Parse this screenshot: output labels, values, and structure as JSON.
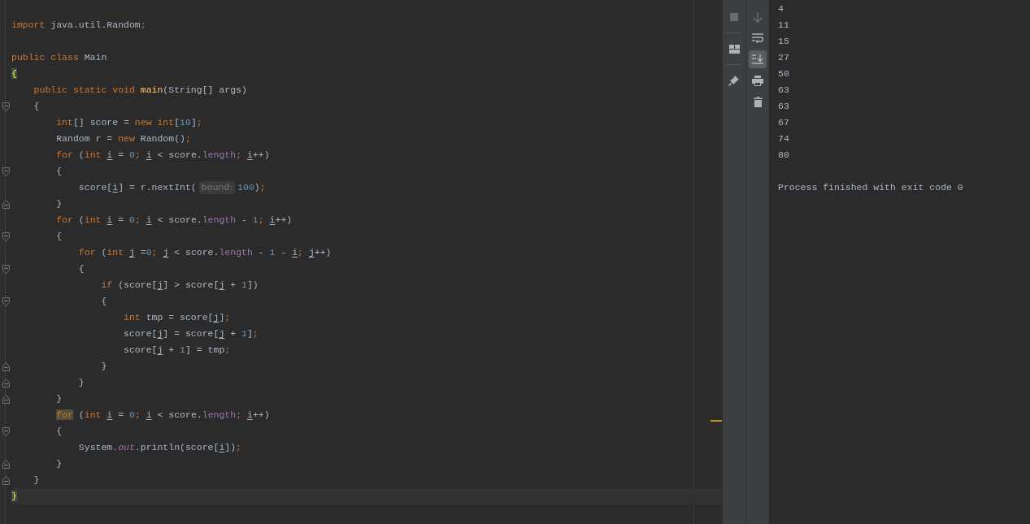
{
  "editor": {
    "lines": [
      {
        "kind": "blank"
      },
      {
        "tokens": [
          {
            "text": "import ",
            "kind": "kw"
          },
          {
            "text": "java.util.Random",
            "kind": "plain"
          },
          {
            "text": ";",
            "kind": "kw"
          }
        ]
      },
      {
        "kind": "blank"
      },
      {
        "tokens": [
          {
            "text": "public class ",
            "kind": "kw"
          },
          {
            "text": "Main",
            "kind": "plain"
          }
        ]
      },
      {
        "tokens": [
          {
            "text": "{",
            "kind": "brace"
          }
        ]
      },
      {
        "tokens": [
          {
            "text": "    public static void ",
            "kind": "kw"
          },
          {
            "text": "main",
            "kind": "method"
          },
          {
            "text": "(String[] args)",
            "kind": "plain"
          }
        ]
      },
      {
        "kind": "block-start",
        "tokens": [
          {
            "text": "    {",
            "kind": "plain"
          }
        ]
      },
      {
        "tokens": [
          {
            "text": "        int",
            "kind": "kw"
          },
          {
            "text": "[] score = ",
            "kind": "plain"
          },
          {
            "text": "new int",
            "kind": "kw"
          },
          {
            "text": "[",
            "kind": "plain"
          },
          {
            "text": "10",
            "kind": "num"
          },
          {
            "text": "]",
            "kind": "plain"
          },
          {
            "text": ";",
            "kind": "kw"
          }
        ]
      },
      {
        "tokens": [
          {
            "text": "        Random r = ",
            "kind": "plain"
          },
          {
            "text": "new ",
            "kind": "kw"
          },
          {
            "text": "Random()",
            "kind": "plain"
          },
          {
            "text": ";",
            "kind": "kw"
          }
        ]
      },
      {
        "tokens": [
          {
            "text": "        for ",
            "kind": "kw"
          },
          {
            "text": "(",
            "kind": "plain"
          },
          {
            "text": "int ",
            "kind": "kw"
          },
          {
            "text": "i",
            "kind": "var"
          },
          {
            "text": " = ",
            "kind": "plain"
          },
          {
            "text": "0",
            "kind": "num"
          },
          {
            "text": "; ",
            "kind": "kw"
          },
          {
            "text": "i",
            "kind": "var"
          },
          {
            "text": " < score.",
            "kind": "plain"
          },
          {
            "text": "length",
            "kind": "field"
          },
          {
            "text": "; ",
            "kind": "kw"
          },
          {
            "text": "i",
            "kind": "var"
          },
          {
            "text": "++)",
            "kind": "plain"
          }
        ]
      },
      {
        "kind": "block-start",
        "tokens": [
          {
            "text": "        {",
            "kind": "plain"
          }
        ]
      },
      {
        "tokens": [
          {
            "text": "            score[",
            "kind": "plain"
          },
          {
            "text": "i",
            "kind": "var"
          },
          {
            "text": "] = r.nextInt(",
            "kind": "plain"
          },
          {
            "text": "bound:",
            "kind": "hint"
          },
          {
            "text": "100",
            "kind": "num"
          },
          {
            "text": ")",
            "kind": "plain"
          },
          {
            "text": ";",
            "kind": "kw"
          }
        ]
      },
      {
        "kind": "block-end",
        "tokens": [
          {
            "text": "        }",
            "kind": "plain"
          }
        ]
      },
      {
        "tokens": [
          {
            "text": "        for ",
            "kind": "kw"
          },
          {
            "text": "(",
            "kind": "plain"
          },
          {
            "text": "int ",
            "kind": "kw"
          },
          {
            "text": "i",
            "kind": "var"
          },
          {
            "text": " = ",
            "kind": "plain"
          },
          {
            "text": "0",
            "kind": "num"
          },
          {
            "text": "; ",
            "kind": "kw"
          },
          {
            "text": "i",
            "kind": "var"
          },
          {
            "text": " < score.",
            "kind": "plain"
          },
          {
            "text": "length",
            "kind": "field"
          },
          {
            "text": " - ",
            "kind": "plain"
          },
          {
            "text": "1",
            "kind": "num"
          },
          {
            "text": "; ",
            "kind": "kw"
          },
          {
            "text": "i",
            "kind": "var"
          },
          {
            "text": "++)",
            "kind": "plain"
          }
        ]
      },
      {
        "kind": "block-start",
        "tokens": [
          {
            "text": "        {",
            "kind": "plain"
          }
        ]
      },
      {
        "tokens": [
          {
            "text": "            for ",
            "kind": "kw"
          },
          {
            "text": "(",
            "kind": "plain"
          },
          {
            "text": "int ",
            "kind": "kw"
          },
          {
            "text": "j",
            "kind": "var"
          },
          {
            "text": " =",
            "kind": "plain"
          },
          {
            "text": "0",
            "kind": "num"
          },
          {
            "text": "; ",
            "kind": "kw"
          },
          {
            "text": "j",
            "kind": "var"
          },
          {
            "text": " < score.",
            "kind": "plain"
          },
          {
            "text": "length",
            "kind": "field"
          },
          {
            "text": " - ",
            "kind": "plain"
          },
          {
            "text": "1",
            "kind": "num"
          },
          {
            "text": " - ",
            "kind": "plain"
          },
          {
            "text": "i",
            "kind": "var"
          },
          {
            "text": "; ",
            "kind": "kw"
          },
          {
            "text": "j",
            "kind": "var"
          },
          {
            "text": "++)",
            "kind": "plain"
          }
        ]
      },
      {
        "kind": "block-start",
        "tokens": [
          {
            "text": "            {",
            "kind": "plain"
          }
        ]
      },
      {
        "tokens": [
          {
            "text": "                if ",
            "kind": "kw"
          },
          {
            "text": "(score[",
            "kind": "plain"
          },
          {
            "text": "j",
            "kind": "var"
          },
          {
            "text": "] > score[",
            "kind": "plain"
          },
          {
            "text": "j",
            "kind": "var"
          },
          {
            "text": " + ",
            "kind": "plain"
          },
          {
            "text": "1",
            "kind": "num"
          },
          {
            "text": "])",
            "kind": "plain"
          }
        ]
      },
      {
        "kind": "block-start",
        "tokens": [
          {
            "text": "                {",
            "kind": "plain"
          }
        ]
      },
      {
        "tokens": [
          {
            "text": "                    int ",
            "kind": "kw"
          },
          {
            "text": "tmp = score[",
            "kind": "plain"
          },
          {
            "text": "j",
            "kind": "var"
          },
          {
            "text": "]",
            "kind": "plain"
          },
          {
            "text": ";",
            "kind": "kw"
          }
        ]
      },
      {
        "tokens": [
          {
            "text": "                    score[",
            "kind": "plain"
          },
          {
            "text": "j",
            "kind": "var"
          },
          {
            "text": "] = score[",
            "kind": "plain"
          },
          {
            "text": "j",
            "kind": "var"
          },
          {
            "text": " + ",
            "kind": "plain"
          },
          {
            "text": "1",
            "kind": "num"
          },
          {
            "text": "]",
            "kind": "plain"
          },
          {
            "text": ";",
            "kind": "kw"
          }
        ]
      },
      {
        "tokens": [
          {
            "text": "                    score[",
            "kind": "plain"
          },
          {
            "text": "j",
            "kind": "var"
          },
          {
            "text": " + ",
            "kind": "plain"
          },
          {
            "text": "1",
            "kind": "num"
          },
          {
            "text": "] = tmp",
            "kind": "plain"
          },
          {
            "text": ";",
            "kind": "kw"
          }
        ]
      },
      {
        "kind": "block-end",
        "tokens": [
          {
            "text": "                }",
            "kind": "plain"
          }
        ]
      },
      {
        "kind": "block-end",
        "tokens": [
          {
            "text": "            }",
            "kind": "plain"
          }
        ]
      },
      {
        "kind": "block-end",
        "tokens": [
          {
            "text": "        }",
            "kind": "plain"
          }
        ]
      },
      {
        "tokens": [
          {
            "text": "        for",
            "kind": "usage"
          },
          {
            "text": " (",
            "kind": "plain"
          },
          {
            "text": "int ",
            "kind": "kw"
          },
          {
            "text": "i",
            "kind": "var"
          },
          {
            "text": " = ",
            "kind": "plain"
          },
          {
            "text": "0",
            "kind": "num"
          },
          {
            "text": "; ",
            "kind": "kw"
          },
          {
            "text": "i",
            "kind": "var"
          },
          {
            "text": " < score.",
            "kind": "plain"
          },
          {
            "text": "length",
            "kind": "field"
          },
          {
            "text": "; ",
            "kind": "kw"
          },
          {
            "text": "i",
            "kind": "var"
          },
          {
            "text": "++)",
            "kind": "plain"
          }
        ]
      },
      {
        "kind": "block-start",
        "tokens": [
          {
            "text": "        {",
            "kind": "plain"
          }
        ]
      },
      {
        "tokens": [
          {
            "text": "            System.",
            "kind": "plain"
          },
          {
            "text": "out",
            "kind": "static"
          },
          {
            "text": ".println(score[",
            "kind": "plain"
          },
          {
            "text": "i",
            "kind": "var"
          },
          {
            "text": "])",
            "kind": "plain"
          },
          {
            "text": ";",
            "kind": "kw"
          }
        ]
      },
      {
        "kind": "block-end",
        "tokens": [
          {
            "text": "        }",
            "kind": "plain"
          }
        ]
      },
      {
        "kind": "block-end",
        "tokens": [
          {
            "text": "    }",
            "kind": "plain"
          }
        ]
      },
      {
        "current": true,
        "tokens": [
          {
            "text": "}",
            "kind": "brace"
          }
        ]
      }
    ]
  },
  "toolbar": {
    "column_1": [
      {
        "kind": "stop",
        "disabled": true
      },
      {
        "kind": "layout",
        "disabled": false
      },
      {
        "kind": "pin",
        "disabled": false
      }
    ],
    "column_2": [
      {
        "kind": "down",
        "disabled": true
      },
      {
        "kind": "wrap",
        "disabled": false,
        "on": false
      },
      {
        "kind": "scroll-end",
        "disabled": false,
        "on": true
      },
      {
        "kind": "print",
        "disabled": false
      },
      {
        "kind": "trash",
        "disabled": false
      }
    ]
  },
  "console": {
    "output": [
      "4",
      "11",
      "15",
      "27",
      "50",
      "63",
      "63",
      "67",
      "74",
      "80"
    ],
    "status": "Process finished with exit code 0"
  }
}
